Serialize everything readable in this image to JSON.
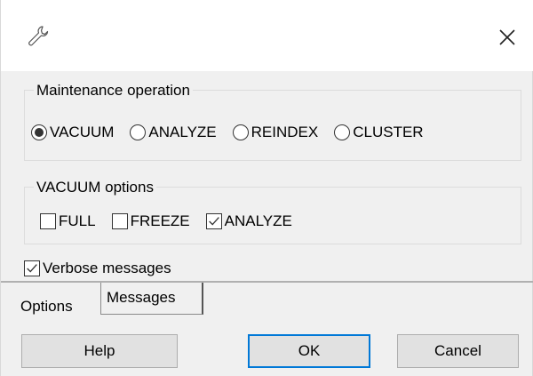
{
  "titlebar": {
    "icon": "wrench-icon",
    "close_icon": "close-icon"
  },
  "maintenance": {
    "label": "Maintenance operation",
    "options": [
      {
        "label": "VACUUM",
        "checked": true
      },
      {
        "label": "ANALYZE",
        "checked": false
      },
      {
        "label": "REINDEX",
        "checked": false
      },
      {
        "label": "CLUSTER",
        "checked": false
      }
    ]
  },
  "vacuum_options": {
    "label": "VACUUM options",
    "options": [
      {
        "label": "FULL",
        "checked": false
      },
      {
        "label": "FREEZE",
        "checked": false
      },
      {
        "label": "ANALYZE",
        "checked": true
      }
    ]
  },
  "verbose": {
    "label": "Verbose messages",
    "checked": true
  },
  "tabs": [
    {
      "label": "Options",
      "active": false
    },
    {
      "label": "Messages",
      "active": true
    }
  ],
  "buttons": {
    "help": "Help",
    "ok": "OK",
    "cancel": "Cancel"
  },
  "colors": {
    "default_button_border": "#0078d7"
  }
}
